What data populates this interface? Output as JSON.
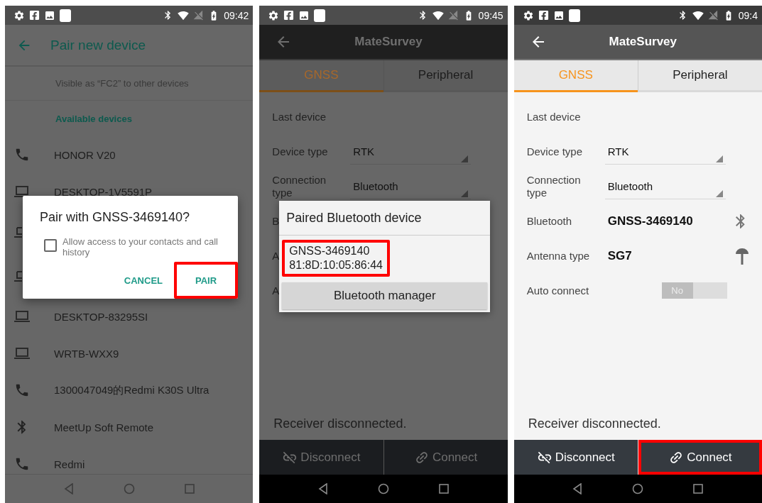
{
  "screens": [
    {
      "kind": "pairing",
      "dimmed": true,
      "status_bar": {
        "time": "09:42"
      },
      "title": "Pair new device",
      "visible_as": "Visible as “FC2” to other devices",
      "section": "Available devices",
      "devices": [
        {
          "kind": "phone",
          "name": "HONOR V20"
        },
        {
          "kind": "laptop",
          "name": "DESKTOP-1V5591P"
        },
        {
          "kind": "laptop"
        },
        {
          "kind": "laptop"
        },
        {
          "kind": "laptop",
          "name": "DESKTOP-83295SI"
        },
        {
          "kind": "laptop",
          "name": "WRTB-WXX9"
        },
        {
          "kind": "phone",
          "name": "1300047049的Redmi K30S Ultra"
        },
        {
          "kind": "bluetooth",
          "name": "MeetUp Soft Remote"
        },
        {
          "kind": "phone",
          "name": "Redmi"
        }
      ],
      "dialog": {
        "title": "Pair with GNSS-3469140?",
        "checkbox": {
          "label": "Allow access to your contacts and call history",
          "checked": false
        },
        "buttons": [
          {
            "label": "CANCEL",
            "highlighted": false
          },
          {
            "label": "PAIR",
            "highlighted": true
          }
        ]
      }
    },
    {
      "kind": "survey",
      "dimmed": true,
      "status_bar": {
        "time": "09:45"
      },
      "title": "MateSurvey",
      "tabs": [
        {
          "label": "GNSS",
          "selected": true
        },
        {
          "label": "Peripheral",
          "selected": false
        }
      ],
      "rows": [
        {
          "kind": "text",
          "label": "Last device"
        },
        {
          "kind": "select",
          "label": "Device type",
          "value": "RTK"
        },
        {
          "kind": "select",
          "label": "Connection type",
          "value": "Bluetooth"
        },
        {
          "kind": "text",
          "label": "B"
        },
        {
          "kind": "text",
          "label": "A"
        },
        {
          "kind": "text",
          "label": "A"
        }
      ],
      "dialog": {
        "title": "Paired Bluetooth device",
        "devices": [
          {
            "name": "GNSS-3469140",
            "address": "81:8D:10:05:86:44",
            "highlighted": true
          }
        ],
        "button": "Bluetooth manager"
      },
      "message": "Receiver disconnected.",
      "actions": [
        {
          "kind": "disconnect",
          "label": "Disconnect",
          "highlighted": false
        },
        {
          "kind": "connect",
          "label": "Connect",
          "highlighted": false
        }
      ]
    },
    {
      "kind": "survey",
      "dimmed": false,
      "status_bar": {
        "time": "09:4"
      },
      "title": "MateSurvey",
      "tabs": [
        {
          "label": "GNSS",
          "selected": true
        },
        {
          "label": "Peripheral",
          "selected": false
        }
      ],
      "rows": [
        {
          "kind": "text",
          "label": "Last device"
        },
        {
          "kind": "select",
          "label": "Device type",
          "value": "RTK"
        },
        {
          "kind": "select",
          "label": "Connection type",
          "value": "Bluetooth"
        },
        {
          "kind": "bluetooth",
          "label": "Bluetooth",
          "value": "GNSS-3469140"
        },
        {
          "kind": "antenna",
          "label": "Antenna type",
          "value": "SG7"
        },
        {
          "kind": "toggle",
          "label": "Auto connect",
          "value": "No",
          "on": false
        }
      ],
      "message": "Receiver disconnected.",
      "actions": [
        {
          "kind": "disconnect",
          "label": "Disconnect",
          "highlighted": false
        },
        {
          "kind": "connect",
          "label": "Connect",
          "highlighted": true
        }
      ]
    }
  ]
}
